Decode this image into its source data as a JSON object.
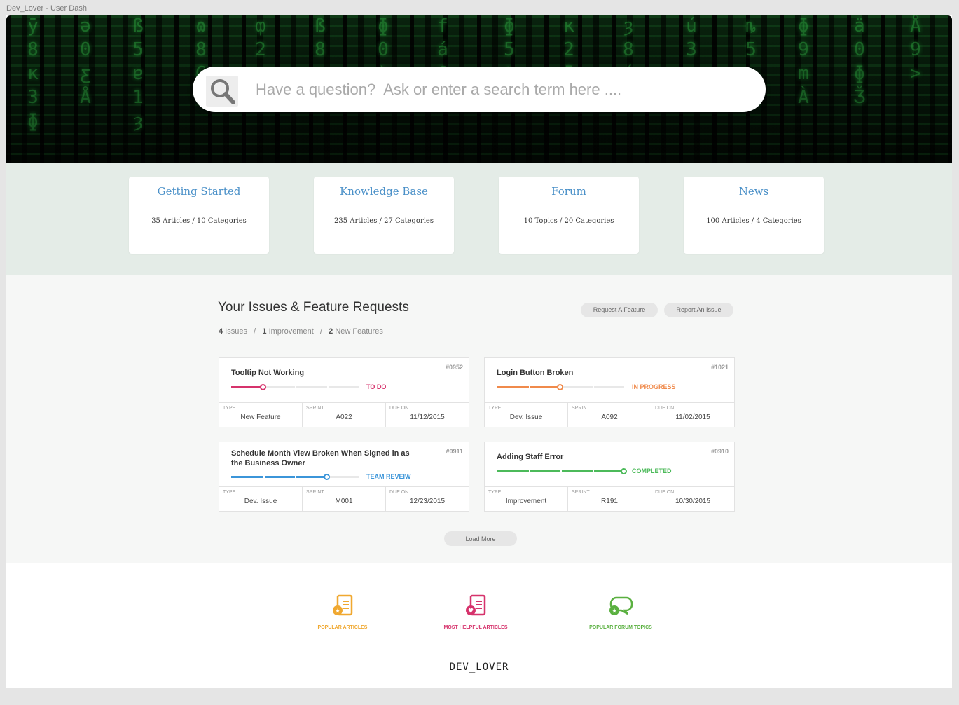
{
  "window": {
    "title": "Dev_Lover - User Dash"
  },
  "colors": {
    "accent_blue": "#4a90c8",
    "todo": "#d6336c",
    "in_progress": "#f08a4b",
    "team_review": "#3b95d9",
    "completed": "#4cba5a",
    "popular": "#f0a830",
    "helpful": "#d6336c",
    "forum": "#5ab040"
  },
  "search": {
    "placeholder": "Have a question?  Ask or enter a search term here ...."
  },
  "categories": [
    {
      "title": "Getting Started",
      "meta": "35 Articles  / 10 Categories"
    },
    {
      "title": "Knowledge Base",
      "meta": "235 Articles  / 27 Categories"
    },
    {
      "title": "Forum",
      "meta": "10 Topics  / 20 Categories"
    },
    {
      "title": "News",
      "meta": "100 Articles  / 4 Categories"
    }
  ],
  "issues": {
    "title": "Your Issues & Feature Requests",
    "summary": {
      "issues_count": "4",
      "issues_label": " Issues",
      "improvement_count": "1",
      "improvement_label": " Improvement",
      "features_count": "2",
      "features_label": " New Features",
      "sep": "/"
    },
    "buttons": {
      "request_feature": "Request A Feature",
      "report_issue": "Report An Issue",
      "load_more": "Load More"
    },
    "labels": {
      "type": "TYPE",
      "sprint": "SPRINT",
      "due": "DUE ON"
    },
    "cards": [
      {
        "title": "Tooltip Not Working",
        "number": "#0952",
        "status": "TO DO",
        "progress": 0.25,
        "type": "New Feature",
        "sprint": "A022",
        "due": "11/12/2015"
      },
      {
        "title": "Login Button Broken",
        "number": "#1021",
        "status": "IN PROGRESS",
        "progress": 0.5,
        "type": "Dev. Issue",
        "sprint": "A092",
        "due": "11/02/2015"
      },
      {
        "title": "Schedule Month View Broken When Signed in as the Business Owner",
        "number": "#0911",
        "status": "TEAM REVEIW",
        "progress": 0.75,
        "type": "Dev. Issue",
        "sprint": "M001",
        "due": "12/23/2015"
      },
      {
        "title": "Adding Staff Error",
        "number": "#0910",
        "status": "COMPLETED",
        "progress": 1.0,
        "type": "Improvement",
        "sprint": "R191",
        "due": "10/30/2015"
      }
    ]
  },
  "quick_links": [
    {
      "label": "POPULAR ARTICLES",
      "icon": "star-document-icon"
    },
    {
      "label": "MOST HELPFUL ARTICLES",
      "icon": "heart-document-icon"
    },
    {
      "label": "POPULAR FORUM TOPICS",
      "icon": "star-chat-bubble-icon"
    }
  ],
  "brand": "DEV_LOVER"
}
